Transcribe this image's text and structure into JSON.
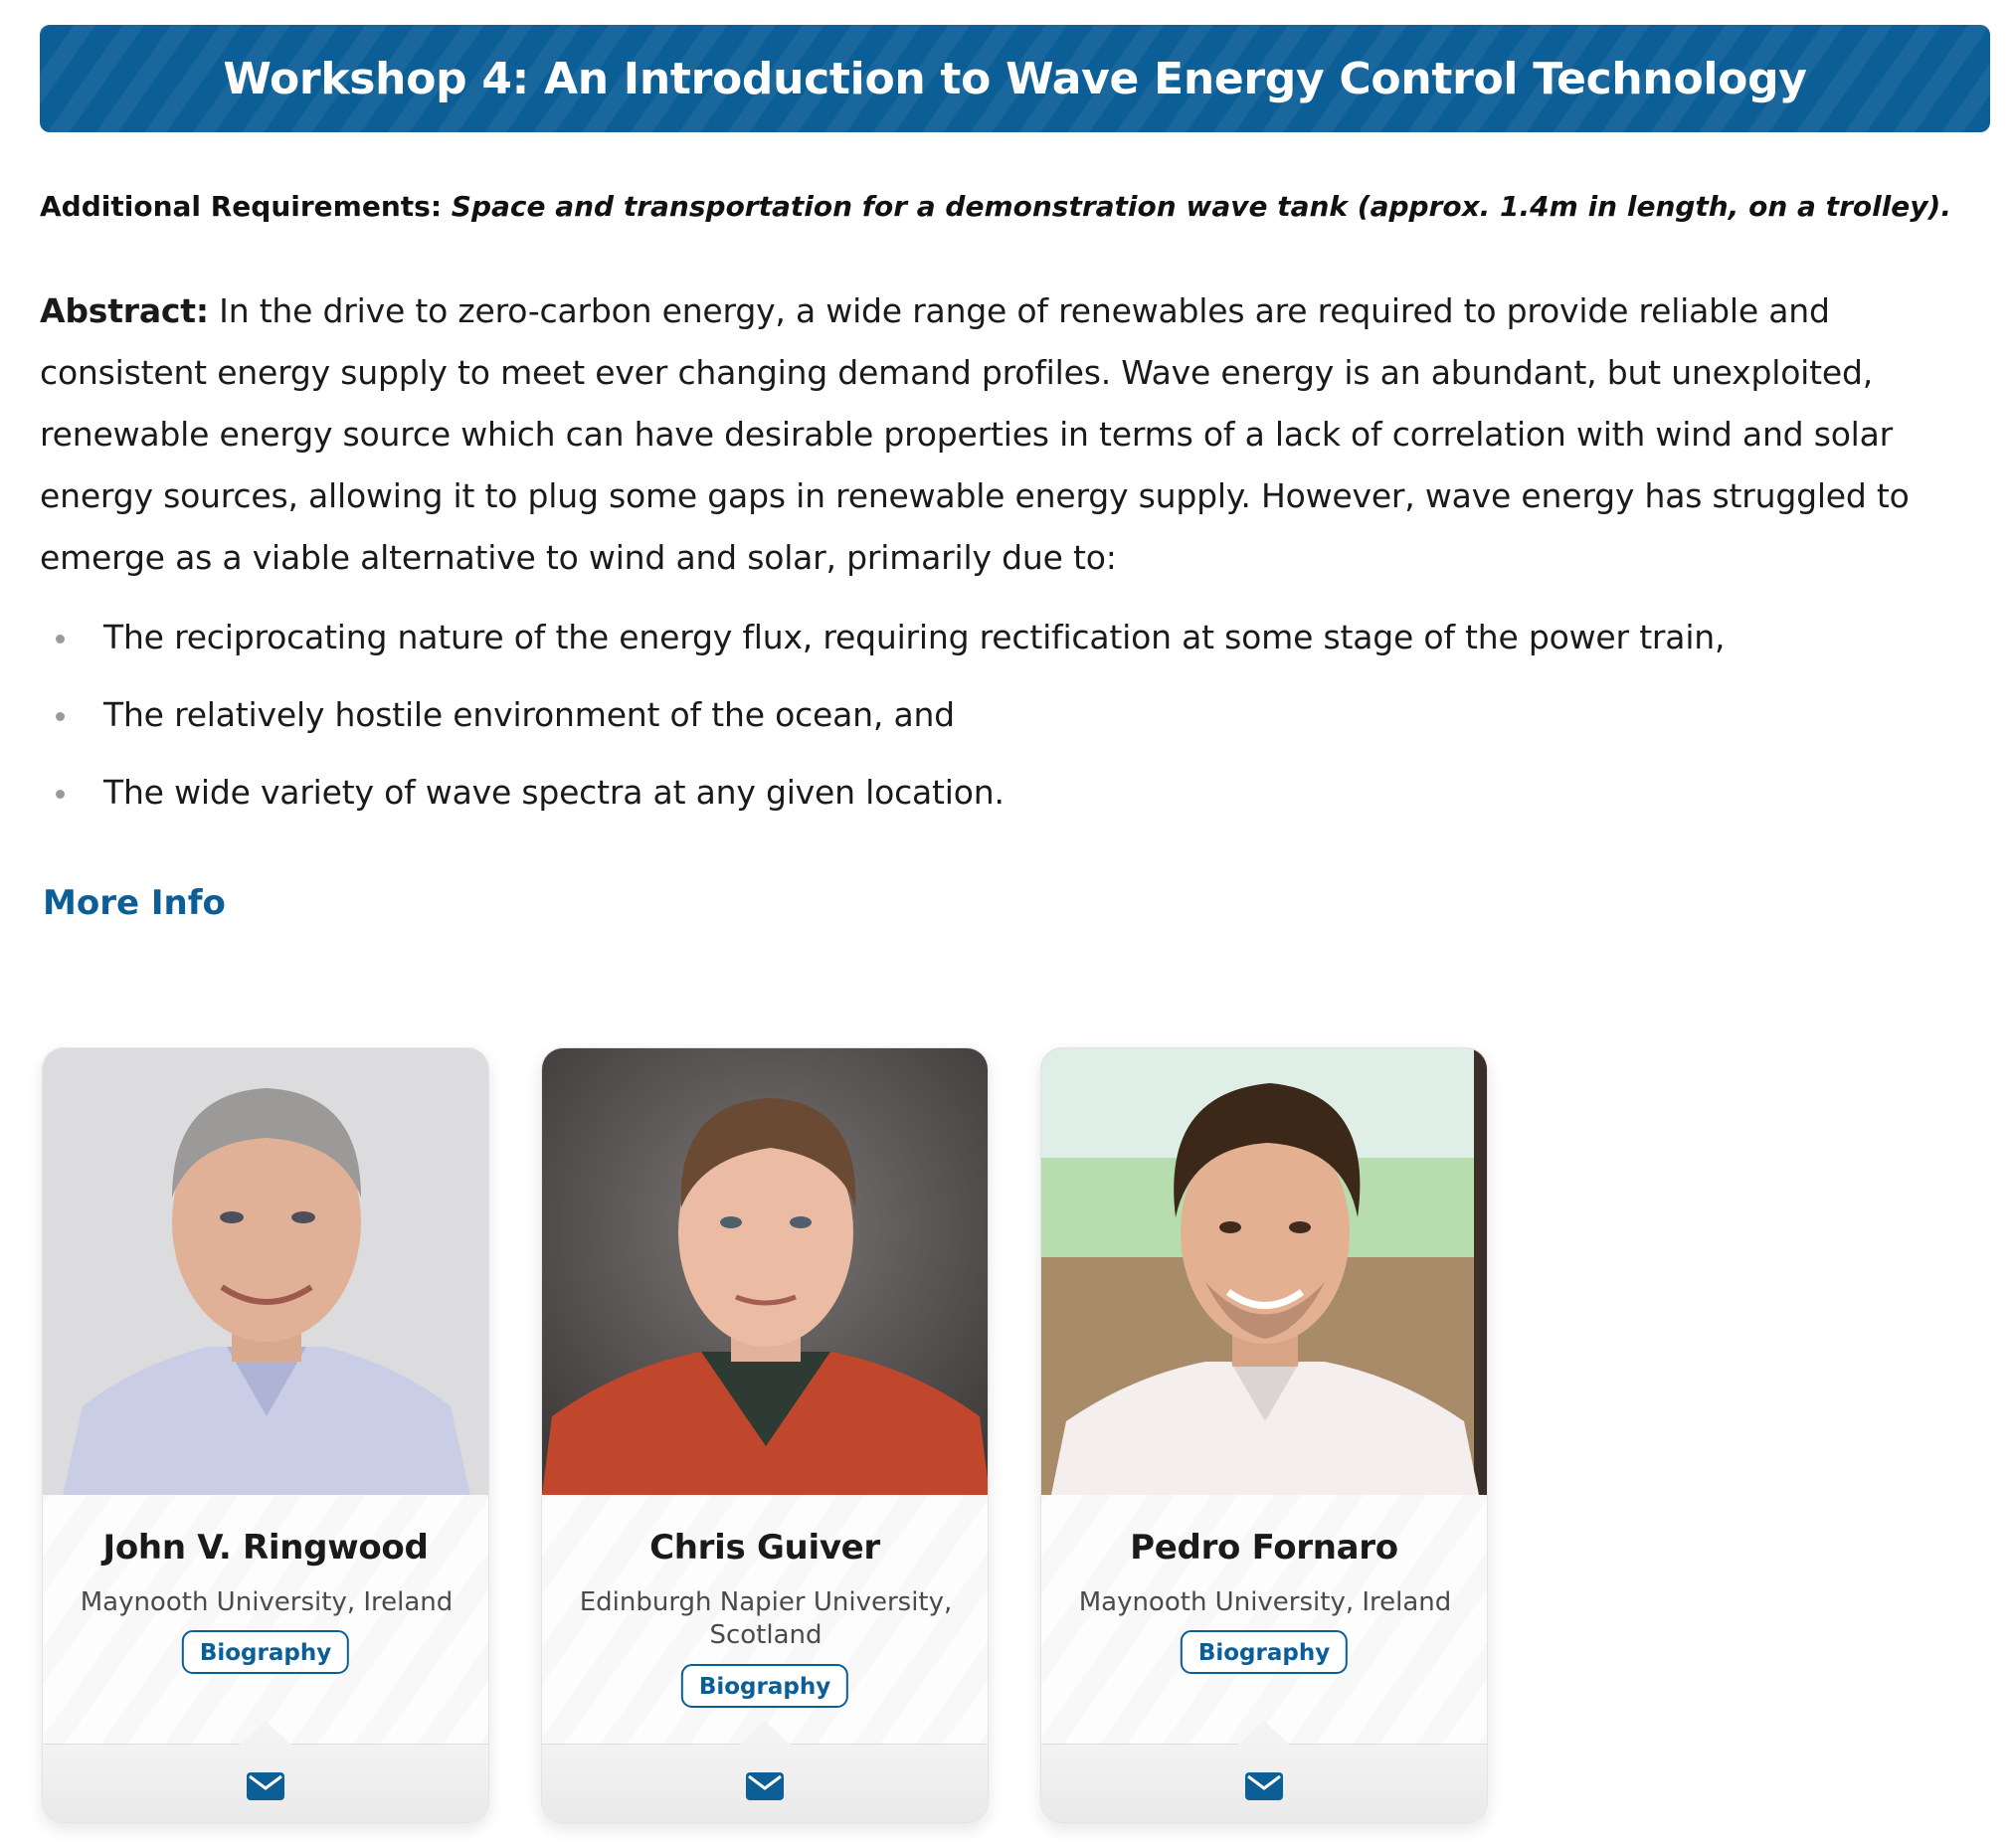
{
  "workshop": {
    "title": "Workshop 4: An Introduction to Wave Energy Control Technology"
  },
  "requirements": {
    "label": "Additional Requirements:",
    "text": "Space and transportation for a demonstration wave tank (approx. 1.4m in length, on a trolley)."
  },
  "abstract": {
    "label": "Abstract:",
    "text": "In the drive to zero-carbon energy, a wide range of renewables are required to provide reliable and consistent energy supply to meet ever changing demand profiles. Wave energy is an abundant, but unexploited, renewable energy source which can have desirable properties in terms of a lack of correlation with wind and solar energy sources, allowing it to plug some gaps in renewable energy supply. However, wave energy has struggled to emerge as a viable alternative to wind and solar, primarily due to:",
    "bullets": [
      "The reciprocating nature of the energy flux, requiring rectification at some stage of the power train,",
      "The relatively hostile environment of the ocean, and",
      "The wide variety of wave spectra at any given location."
    ]
  },
  "more_info": {
    "label": "More Info"
  },
  "speakers": [
    {
      "name": "John V. Ringwood",
      "affiliation": "Maynooth University, Ireland",
      "button": "Biography",
      "icon": "envelope-icon"
    },
    {
      "name": "Chris Guiver",
      "affiliation": "Edinburgh Napier University, Scotland",
      "button": "Biography",
      "icon": "envelope-icon"
    },
    {
      "name": "Pedro Fornaro",
      "affiliation": "Maynooth University, Ireland",
      "button": "Biography",
      "icon": "envelope-icon"
    }
  ],
  "colors": {
    "brand_blue": "#0b5e96",
    "text": "#1a1a1a",
    "muted_text": "#4a4a4a"
  }
}
